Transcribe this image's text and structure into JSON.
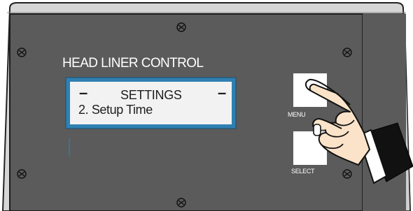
{
  "panel": {
    "title": "HEAD LINER CONTROL"
  },
  "display": {
    "dash_left": "–",
    "dash_right": "–",
    "line1": "SETTINGS",
    "line2": "2. Setup Time"
  },
  "buttons": {
    "menu_label": "MENU",
    "select_label": "SELECT"
  },
  "colors": {
    "panel": "#5a5a5a",
    "frame": "#c8c8c8",
    "screen_border": "#2e7fb0",
    "screen": "#f2f2f2"
  }
}
